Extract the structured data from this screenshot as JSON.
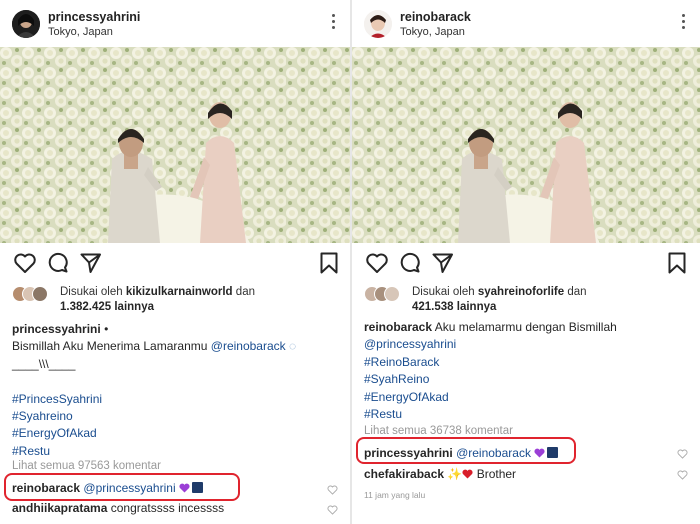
{
  "left": {
    "username": "princessyahrini",
    "location": "Tokyo, Japan",
    "liked_by_prefix": "Disukai oleh",
    "liked_by_user": "kikizulkarnainworld",
    "liked_by_and": "dan",
    "likes_count": "1.382.425 lainnya",
    "caption_author": "princessyahrini",
    "caption_bullet": "•",
    "caption_text": "Bismillah Aku Menerima Lamaranmu",
    "caption_mention": "@reinobarack",
    "caption_line2": "____\\\\\\____",
    "hashtags": [
      "#PrincesSyahrini",
      "#Syahreino",
      "#EnergyOfAkad",
      "#Restu"
    ],
    "view_all": "Lihat semua 97563 komentar",
    "comment1_user": "reinobarack",
    "comment1_mention": "@princessyahrini",
    "comment2_user": "andhiikapratama",
    "comment2_text": "congratssss incessss"
  },
  "right": {
    "username": "reinobarack",
    "location": "Tokyo, Japan",
    "liked_by_prefix": "Disukai oleh",
    "liked_by_user": "syahreinoforlife",
    "liked_by_and": "dan",
    "likes_count": "421.538 lainnya",
    "caption_author": "reinobarack",
    "caption_text": "Aku melamarmu dengan Bismillah",
    "caption_mention": "@princessyahrini",
    "hashtags": [
      "#ReinoBarack",
      "#SyahReino",
      "#EnergyOfAkad",
      "#Restu"
    ],
    "view_all": "Lihat semua 36738 komentar",
    "comment1_user": "princessyahrini",
    "comment1_mention": "@reinobarack",
    "comment2_user": "chefakiraback",
    "comment2_text": "Brother",
    "time_ago": "11 jam yang lalu"
  },
  "icons": {
    "like": "heart-icon",
    "comment": "comment-icon",
    "share": "send-icon",
    "save": "bookmark-icon",
    "more": "more-vertical-icon"
  },
  "colors": {
    "highlight": "#e0242e",
    "link": "#1a4d8f",
    "emoji_heart": "#9b3fd6"
  }
}
